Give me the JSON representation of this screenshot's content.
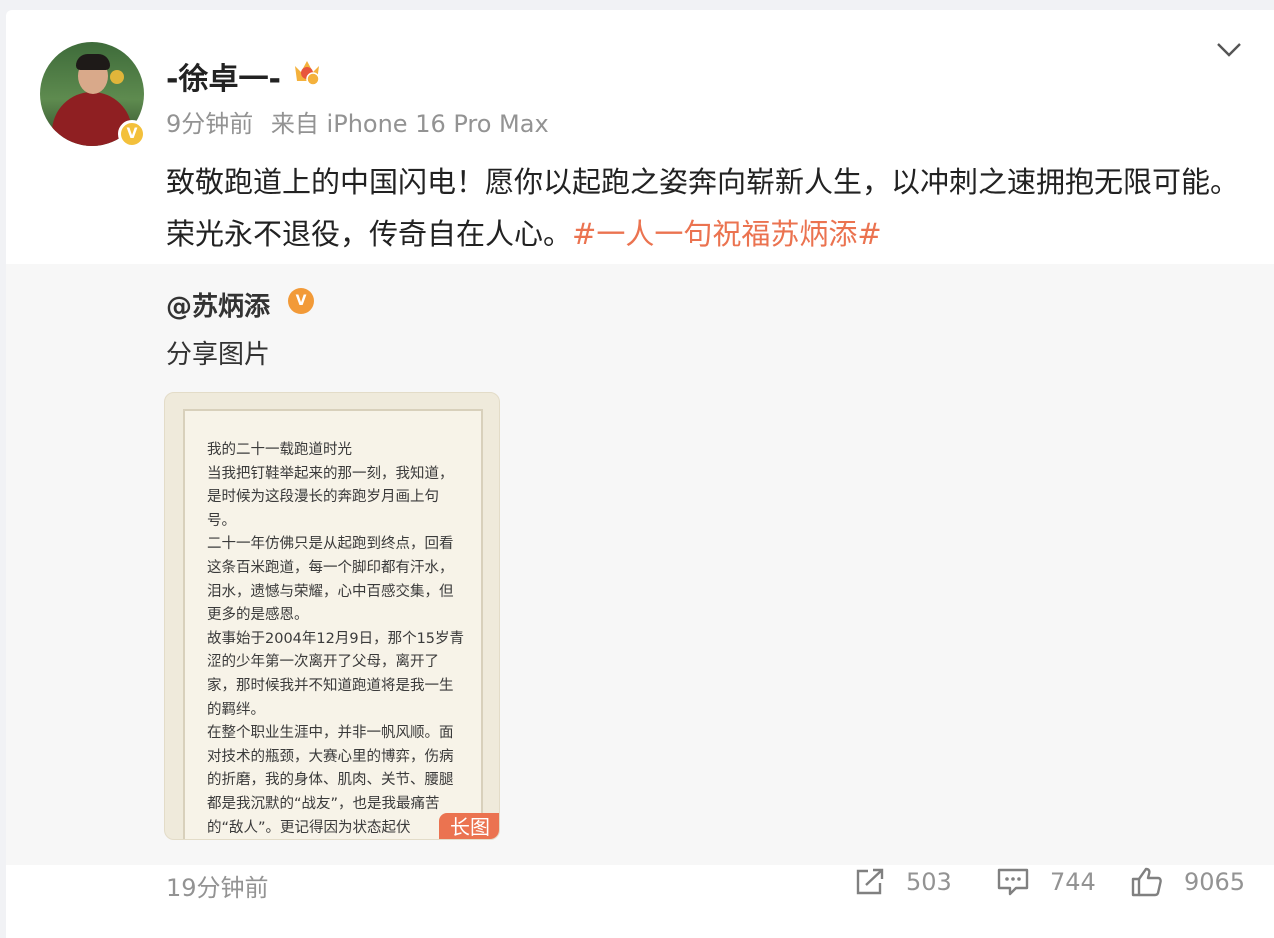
{
  "post": {
    "user_name": "-徐卓一-",
    "verify_badge": "V",
    "time": "9分钟前",
    "source": "来自 iPhone 16 Pro Max",
    "text": "致敬跑道上的中国闪电！愿你以起跑之姿奔向崭新人生，以冲刺之速拥抱无限可能。荣光永不退役，传奇自在人心。",
    "hashtag": "#一人一句祝福苏炳添#"
  },
  "retweet": {
    "user": "@苏炳添",
    "badge": "V",
    "text": "分享图片",
    "image_badge": "长图",
    "image_lines": [
      "我的二十一载跑道时光",
      "当我把钉鞋举起来的那一刻，我知道，是时候为这段漫长的奔跑岁月画上句号。",
      "二十一年仿佛只是从起跑到终点，回看这条百米跑道，每一个脚印都有汗水，泪水，遗憾与荣耀，心中百感交集，但更多的是感恩。",
      "故事始于2004年12月9日，那个15岁青涩的少年第一次离开了父母，离开了家，那时候我并不知道跑道将是我一生的羁绊。",
      "在整个职业生涯中，并非一帆风顺。面对技术的瓶颈，大赛心里的博弈，伤病的折磨，我的身体、肌肉、关节、腰腿都是我沉默的“战友”，也是我最痛苦的“敌人”。更记得因为状态起伏"
    ],
    "time": "19分钟前",
    "reposts": "503",
    "comments": "744",
    "likes": "9065"
  },
  "colors": {
    "hashtag": "#eb7350",
    "meta_gray": "#939393",
    "retweet_bg": "#f7f7f7"
  },
  "icons": [
    "crown-badge-icon",
    "chevron-down-icon",
    "repost-icon",
    "comment-icon",
    "like-icon"
  ]
}
